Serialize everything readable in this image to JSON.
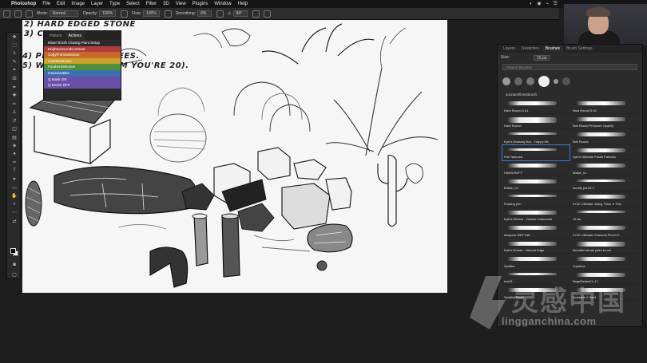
{
  "menubar": {
    "app": "Photoshop",
    "items": [
      "File",
      "Edit",
      "Image",
      "Layer",
      "Type",
      "Select",
      "Filter",
      "3D",
      "View",
      "Plugins",
      "Window",
      "Help"
    ]
  },
  "options": {
    "mode_label": "Mode:",
    "mode_value": "Normal",
    "opacity_label": "Opacity:",
    "opacity_value": "100%",
    "flow_label": "Flow:",
    "flow_value": "100%",
    "smoothing_label": "Smoothing:",
    "smoothing_value": "0%",
    "angle_value": "84°"
  },
  "canvas_text": {
    "line1": "2) HARD EDGED STONE",
    "line2": "3) CO",
    "line3": "4) PLA                US, PALM TREES.",
    "line4": "5) WO              AYOUTS (FROM YOU'RE 20)."
  },
  "actions_panel": {
    "tabs": [
      "History",
      "Actions"
    ],
    "items": [
      {
        "label": "Mixer Brush Cloning Paint Setup",
        "color": "#2b2b2b"
      },
      {
        "label": "BrightnessAndContrast",
        "color": "#b23b3b"
      },
      {
        "label": "CopyFromSelection",
        "color": "#c46a2b"
      },
      {
        "label": "InvertSelection",
        "color": "#c9a12b"
      },
      {
        "label": "FeatherSelection",
        "color": "#4f8f3a"
      },
      {
        "label": "GaussianBlur",
        "color": "#3b6fb0"
      },
      {
        "label": "Q Mask ON",
        "color": "#6a4fa8"
      },
      {
        "label": "Q MASK OFF",
        "color": "#6a4fa8"
      }
    ]
  },
  "brushes_panel": {
    "tabs": [
      "Layers",
      "Swatches",
      "Brushes",
      "Brush Settings"
    ],
    "active_tab": "Brushes",
    "size_label": "Size:",
    "size_value": "15 px",
    "search_placeholder": "Search Brushes",
    "group_name": "socratesfinestbrush",
    "brushes": [
      "Hard Round 4 #1",
      "Hard Round 5 #1",
      "Hard Round",
      "Soft Round Pressure Opacity",
      "Kyle's Drawing Box - Happy Hit",
      "Soft Round",
      "Flat Tamured",
      "Kyle's Ultimate Pastel Palooza",
      "HARD/SOFT",
      "Bristle_01",
      "Bristle_02",
      "Scruffy pencil 2",
      "Flowing pen",
      "KYLE Ultimate Inking Thick 'n Thin",
      "Kyle's Webos - Classic Cartoonist",
      "hit ink",
      "ahsyoon WET INK",
      "KYLE Ultimate Charcoal Pencil 2...",
      "Kyle's Eraser - Natural Edge",
      "Beautiful streak paint brush",
      "Splatter",
      "Jopalone",
      "text01",
      "NagelSeries21-17",
      "Splatter Brush",
      "Gouache 2 Hard"
    ]
  },
  "watermark": {
    "cn": "灵感中国",
    "en": "lingganchina.com"
  }
}
